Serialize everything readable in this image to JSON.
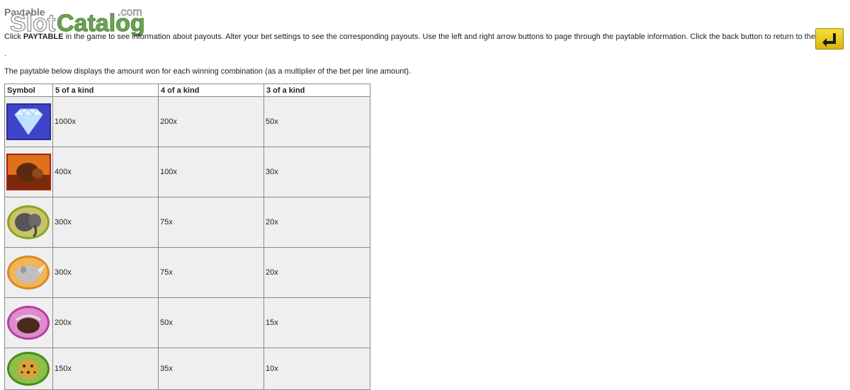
{
  "page": {
    "heading": "Paytable",
    "intro_pre": "Click ",
    "intro_bold": "PAYTABLE",
    "intro_post": " in the game to see information about payouts. Alter your bet settings to see the corresponding payouts. Use the left and right arrow buttons to page through the paytable information. Click the back button to return to the game.",
    "dot": ".",
    "description": "The paytable below displays the amount won for each winning combination (as a multiplier of the bet per line amount).",
    "back_icon": "back-arrow-icon",
    "watermark": {
      "text_main": "SlotCatalog",
      "text_suffix": ".com"
    }
  },
  "table": {
    "headers": [
      "Symbol",
      "5 of a kind",
      "4 of a kind",
      "3 of a kind"
    ],
    "rows": [
      {
        "symbol": "diamond",
        "five": "1000x",
        "four": "200x",
        "three": "50x"
      },
      {
        "symbol": "lion",
        "five": "400x",
        "four": "100x",
        "three": "30x"
      },
      {
        "symbol": "elephant",
        "five": "300x",
        "four": "75x",
        "three": "20x"
      },
      {
        "symbol": "rhino",
        "five": "300x",
        "four": "75x",
        "three": "20x"
      },
      {
        "symbol": "buffalo",
        "five": "200x",
        "four": "50x",
        "three": "15x"
      },
      {
        "symbol": "leopard",
        "five": "150x",
        "four": "35x",
        "three": "10x"
      }
    ]
  },
  "colors": {
    "accent_green": "#6aa84f",
    "back_button_yellow": "#f2d21c"
  }
}
